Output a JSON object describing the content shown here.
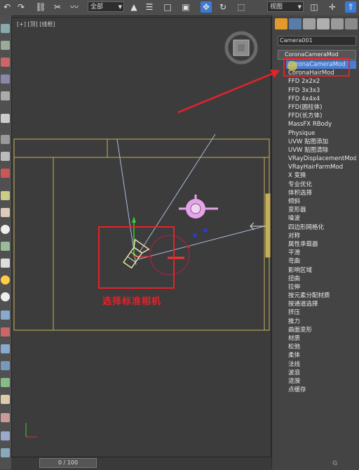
{
  "toolbar": {
    "selection_filter": "全部",
    "view_coord": "视图",
    "icons": [
      "undo-icon",
      "redo-icon",
      "link-icon",
      "unlink-icon",
      "bind-space-warp-icon",
      "select-object-icon",
      "select-by-name-icon",
      "rectangular-selection-icon",
      "window-crossing-icon",
      "select-and-move-icon",
      "select-and-rotate-icon",
      "select-and-scale-icon",
      "use-pivot-center-icon",
      "select-and-manipulate-icon",
      "keyboard-shortcut-icon",
      "snaps-icon",
      "mirror-icon"
    ]
  },
  "viewport": {
    "label": "[+] [顶] [线框]",
    "time_slider": "0 / 100",
    "annotation": "选择标准相机"
  },
  "command_panel": {
    "tabs": [
      "create-tab",
      "modify-tab",
      "hierarchy-tab",
      "motion-tab",
      "display-tab",
      "utilities-tab"
    ],
    "object_name": "Camera001",
    "modifier_dropdown": "CoronaCameraMod",
    "modifier_list": [
      "CoronaCameraMod",
      "CoronaHairMod",
      "FFD 2x2x2",
      "FFD 3x3x3",
      "FFD 4x4x4",
      "FFD(圆柱体)",
      "FFD(长方体)",
      "MassFX RBody",
      "Physique",
      "UVW 贴图添加",
      "UVW 贴图清除",
      "VRayDisplacementMod",
      "VRayHairFarmMod",
      "X 变换",
      "专业优化",
      "体积选择",
      "倾斜",
      "变形器",
      "噪波",
      "四边形网格化",
      "对称",
      "属性承载器",
      "平滑",
      "弯曲",
      "影响区域",
      "扭曲",
      "拉伸",
      "按元素分配材质",
      "按通道选择",
      "挤压",
      "推力",
      "曲面变形",
      "材质",
      "松弛",
      "柔体",
      "法线",
      "波浪",
      "涟漪",
      "点缓存"
    ],
    "selected_index": 0
  },
  "colors": {
    "annotation_red": "#e4222a",
    "highlight_blue": "#4a7ed0",
    "camera_line": "#a9bbd8",
    "safe_frame": "#c6b05a",
    "light_pink": "#e6a3e9"
  },
  "watermark": "G"
}
